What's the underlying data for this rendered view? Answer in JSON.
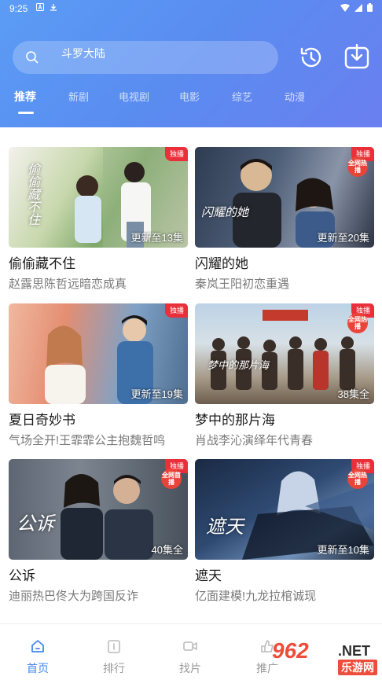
{
  "status": {
    "time": "9:25"
  },
  "search": {
    "placeholder": "斗罗大陆"
  },
  "tabs": [
    {
      "label": "推荐",
      "active": true
    },
    {
      "label": "新剧"
    },
    {
      "label": "电视剧"
    },
    {
      "label": "电影"
    },
    {
      "label": "综艺"
    },
    {
      "label": "动漫"
    }
  ],
  "cards": [
    {
      "title": "偷偷藏不住",
      "subtitle": "赵露思陈哲远暗恋成真",
      "episodes": "更新至13集",
      "badge": "独播",
      "poster_text": "偷偷藏不住"
    },
    {
      "title": "闪耀的她",
      "subtitle": "秦岚王阳初恋重遇",
      "episodes": "更新至20集",
      "badge": "独播",
      "hot": "全网热播",
      "poster_text": "闪耀的她"
    },
    {
      "title": "夏日奇妙书",
      "subtitle": "气场全开!王霏霏公主抱魏哲鸣",
      "episodes": "更新至19集",
      "badge": "独播"
    },
    {
      "title": "梦中的那片海",
      "subtitle": "肖战李沁演绎年代青春",
      "episodes": "38集全",
      "badge": "独播",
      "hot": "全网热播",
      "poster_text": "梦中的那片海"
    },
    {
      "title": "公诉",
      "subtitle": "迪丽热巴佟大为跨国反诈",
      "episodes": "40集全",
      "badge": "独播",
      "hot": "全网首播",
      "poster_text": "公诉"
    },
    {
      "title": "遮天",
      "subtitle": "亿面建模!九龙拉棺诚现",
      "episodes": "更新至10集",
      "badge": "独播",
      "hot": "全网热播",
      "poster_text": "遮天"
    }
  ],
  "nav": [
    {
      "label": "首页",
      "icon": "home-icon",
      "active": true
    },
    {
      "label": "排行",
      "icon": "ranking-icon"
    },
    {
      "label": "找片",
      "icon": "video-icon"
    },
    {
      "label": "推广",
      "icon": "promote-icon"
    }
  ],
  "watermark": {
    "number": "962",
    "domain": ".NET",
    "site": "乐游网"
  },
  "colors": {
    "accent": "#3f88f3",
    "badge": "#ea2f3a",
    "header": "#5b9cf6"
  }
}
